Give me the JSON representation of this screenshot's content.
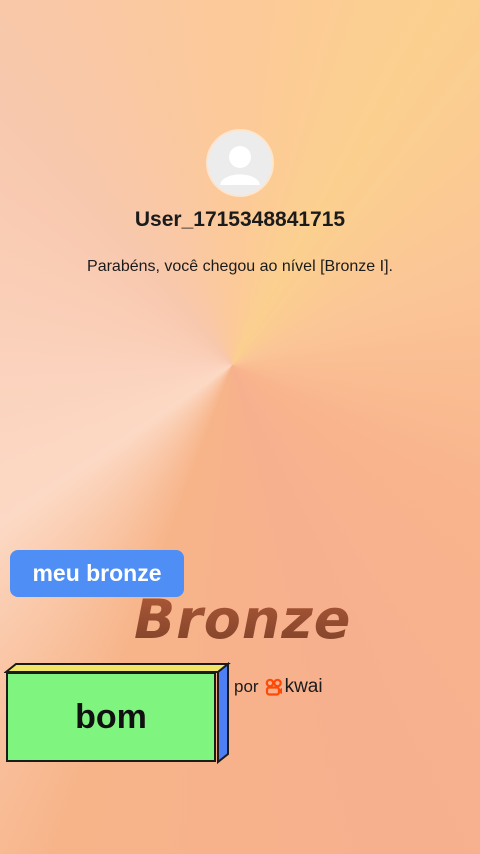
{
  "profile": {
    "avatar_icon": "default-user-avatar-icon",
    "username": "User_1715348841715",
    "message": "Parabéns, você chegou ao nível [Bronze I]."
  },
  "stickers": {
    "blue_label": "meu bronze",
    "box_label": "bom",
    "blue_color": "#4f8ef5",
    "box_color": "#7ff57f"
  },
  "badge": {
    "level_title": "Bronze",
    "by_label": "por",
    "brand_name": "kwai",
    "brand_icon": "kwai-logo-icon",
    "brand_color": "#ff4906"
  }
}
